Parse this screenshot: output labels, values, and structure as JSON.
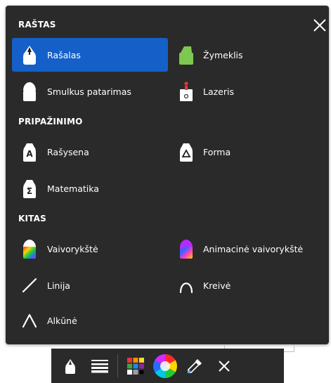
{
  "panel": {
    "close_icon": "close-icon",
    "sections": [
      {
        "title": "RAŠTAS",
        "items": [
          {
            "label": "Rašalas",
            "icon": "pen-icon",
            "active": true
          },
          {
            "label": "Žymeklis",
            "icon": "highlighter-icon"
          },
          {
            "label": "Smulkus patarimas",
            "icon": "fine-tip-icon"
          },
          {
            "label": "Lazeris",
            "icon": "laser-icon"
          }
        ]
      },
      {
        "title": "PRIPAŽINIMO",
        "items": [
          {
            "label": "Rašysena",
            "icon": "handwriting-icon"
          },
          {
            "label": "Forma",
            "icon": "shape-icon"
          },
          {
            "label": "Matematika",
            "icon": "math-icon"
          }
        ]
      },
      {
        "title": "KITAS",
        "items": [
          {
            "label": "Vaivorykštė",
            "icon": "rainbow-pen-icon"
          },
          {
            "label": "Animacinė vaivorykštė",
            "icon": "animated-rainbow-pen-icon"
          },
          {
            "label": "Linija",
            "icon": "line-icon"
          },
          {
            "label": "Kreivė",
            "icon": "curve-icon"
          },
          {
            "label": "Alkūnė",
            "icon": "elbow-icon"
          }
        ]
      }
    ]
  },
  "toolbar": {
    "items": [
      "pen-icon",
      "line-weight-icon",
      "color-palette-icon",
      "color-wheel-icon",
      "eyedropper-icon",
      "close-icon"
    ]
  },
  "colors": {
    "panel_bg": "#2a2a2a",
    "active_bg": "#1460c8",
    "highlighter": "#7ec850",
    "laser": "#e53935"
  }
}
